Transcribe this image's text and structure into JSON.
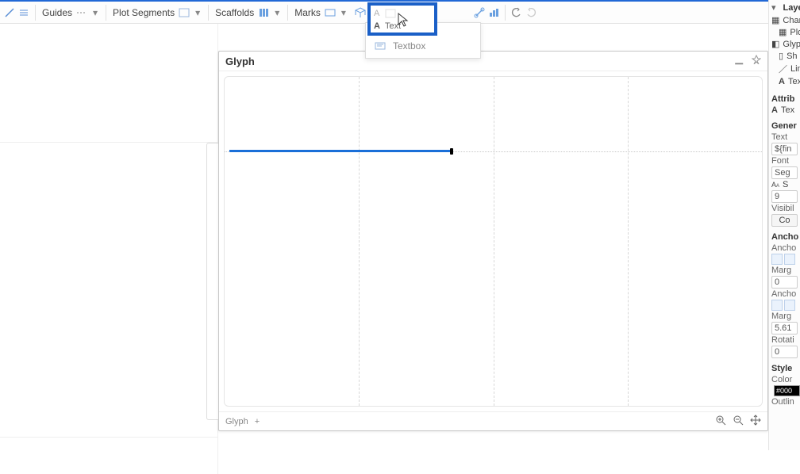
{
  "toolbar": {
    "guides_label": "Guides",
    "plot_segments_label": "Plot Segments",
    "scaffolds_label": "Scaffolds",
    "marks_label": "Marks"
  },
  "popup": {
    "row1_a": "A",
    "row2_a": "A",
    "row2_label": "Text"
  },
  "dropdown": {
    "textbox_label": "Textbox"
  },
  "glyph": {
    "title": "Glyph",
    "tab_label": "Glyph",
    "plus": "+"
  },
  "right": {
    "layers_label": "Layers",
    "chart_label": "Chart",
    "plo_label": "Plo",
    "glyph_label": "Glyph",
    "sh_label": "Sh",
    "lin_label": "Lin",
    "tex_label": "Tex",
    "attrib_label": "Attrib",
    "tex2_label": "Tex",
    "gener_label": "Gener",
    "text_label": "Text",
    "text_value": "${fin",
    "font_label": "Font",
    "font_value": "Seg",
    "size_prefix": "S",
    "size_value": "9",
    "visibil_label": "Visibil",
    "visibil_value": "Co",
    "anchor_section": "Ancho",
    "anchor_label": "Ancho",
    "margin_label": "Marg",
    "margin_value": "0",
    "anchor2_label": "Ancho",
    "margin2_label": "Marg",
    "margin2_value": "5.61",
    "rotati_label": "Rotati",
    "rotati_value": "0",
    "style_label": "Style",
    "color_label": "Color",
    "color_value": "#000",
    "outlin_label": "Outlin"
  }
}
